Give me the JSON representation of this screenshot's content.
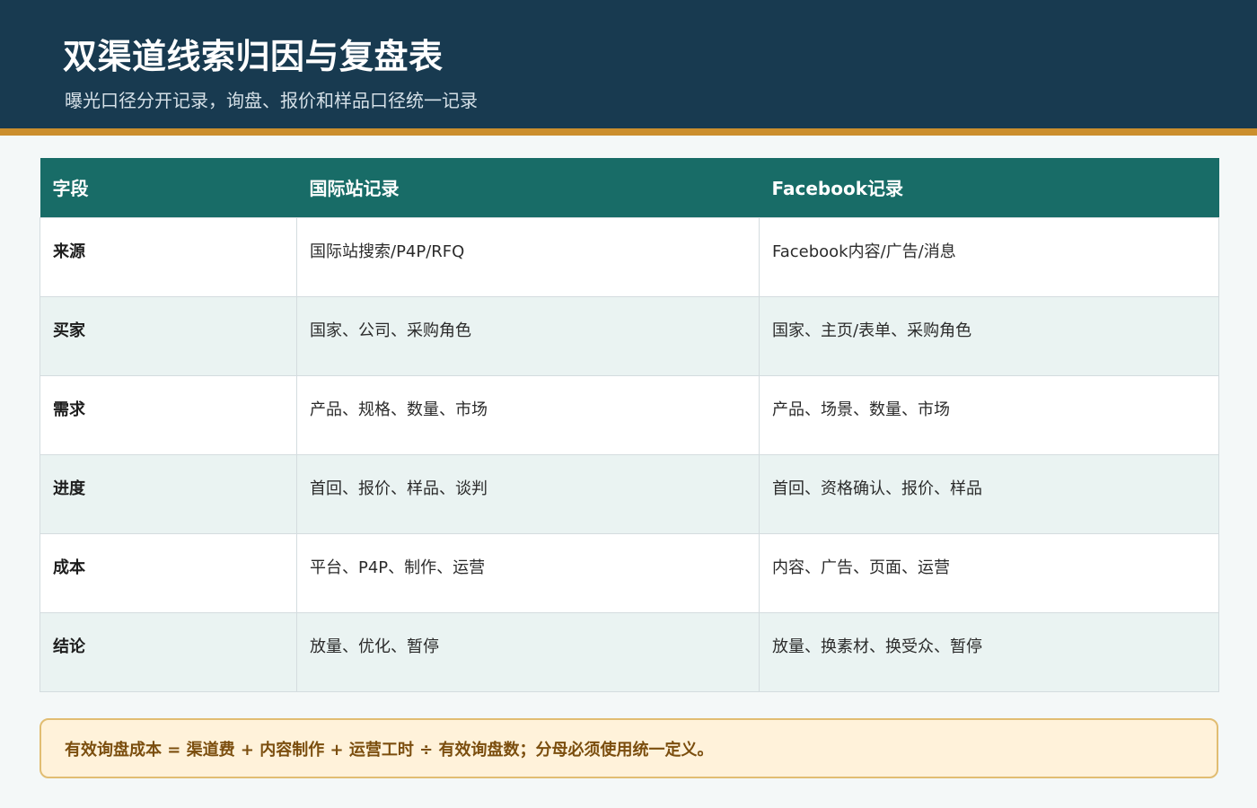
{
  "header": {
    "title": "双渠道线索归因与复盘表",
    "subtitle": "曝光口径分开记录，询盘、报价和样品口径统一记录"
  },
  "table": {
    "columns": [
      "字段",
      "国际站记录",
      "Facebook记录"
    ],
    "rows": [
      [
        "来源",
        "国际站搜索/P4P/RFQ",
        "Facebook内容/广告/消息"
      ],
      [
        "买家",
        "国家、公司、采购角色",
        "国家、主页/表单、采购角色"
      ],
      [
        "需求",
        "产品、规格、数量、市场",
        "产品、场景、数量、市场"
      ],
      [
        "进度",
        "首回、报价、样品、谈判",
        "首回、资格确认、报价、样品"
      ],
      [
        "成本",
        "平台、P4P、制作、运营",
        "内容、广告、页面、运营"
      ],
      [
        "结论",
        "放量、优化、暂停",
        "放量、换素材、换受众、暂停"
      ]
    ]
  },
  "note": {
    "text": "有效询盘成本 = 渠道费 + 内容制作 + 运营工时 ÷ 有效询盘数；分母必须使用统一定义。"
  },
  "colors": {
    "header_bg": "#183a50",
    "accent_stripe": "#cb8f2e",
    "table_header_bg": "#186c67",
    "row_alt_bg": "#eaf3f2",
    "note_bg": "#fff2da",
    "note_text": "#7b4e0e"
  }
}
